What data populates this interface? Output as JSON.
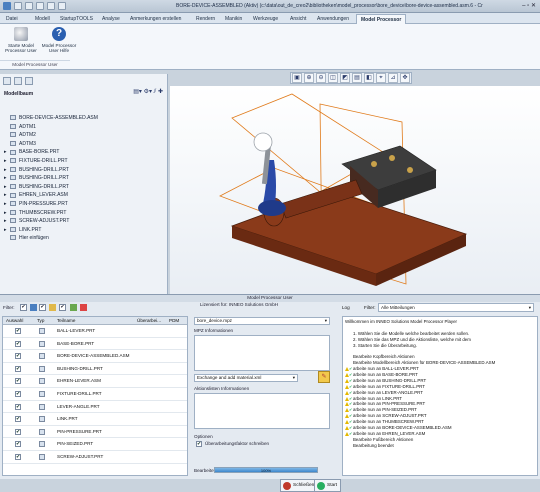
{
  "titlebar": {
    "title": "BORE-DEVICE-ASSEMBLED (Aktiv) (c:\\data\\out_de_creo2\\bibliotheken\\model_processor\\bore_device\\bore-device-assembled.asm.6 - Cr"
  },
  "ribbon": {
    "tabs": [
      "Datei",
      "Modell",
      "StartupTOOLS",
      "Analyse",
      "Anmerkungen erstellen",
      "Rendern",
      "Manikin",
      "Werkzeuge",
      "Ansicht",
      "Anwendungen",
      "Model Processor"
    ],
    "active_tab": "Model Processor",
    "buttons": [
      {
        "label": "Starte Model Processor User",
        "icon": "model-processor-icon"
      },
      {
        "label": "Model Processor User Hilfe",
        "icon": "help-icon"
      }
    ],
    "group_label": "Model Processor User"
  },
  "model_tree": {
    "header": "Modellbaum",
    "items": [
      {
        "label": "BORE-DEVICE-ASSEMBLED.ASM",
        "expand": ""
      },
      {
        "label": "ADTM1",
        "expand": ""
      },
      {
        "label": "ADTM2",
        "expand": ""
      },
      {
        "label": "ADTM3",
        "expand": ""
      },
      {
        "label": "BASE-BORE.PRT",
        "expand": "▸"
      },
      {
        "label": "FIXTURE-DRILL.PRT",
        "expand": "▸"
      },
      {
        "label": "BUSHING-DRILL.PRT",
        "expand": "▸"
      },
      {
        "label": "BUSHING-DRILL.PRT",
        "expand": "▸"
      },
      {
        "label": "BUSHING-DRILL.PRT",
        "expand": "▸"
      },
      {
        "label": "EHREN_LEVER.ASM",
        "expand": "▸"
      },
      {
        "label": "PIN-PRESSURE.PRT",
        "expand": "▸"
      },
      {
        "label": "THUMBSCREW.PRT",
        "expand": "▸"
      },
      {
        "label": "SCREW-ADJUST.PRT",
        "expand": "▸"
      },
      {
        "label": "LINK.PRT",
        "expand": "▸"
      },
      {
        "label": "Hier einfügen",
        "expand": ""
      }
    ]
  },
  "mpp": {
    "title": "Model Processor User",
    "filter_label": "Filter:",
    "license": "Lizensiert für:   INNEO Solutions GmbH",
    "log_label": "Log",
    "log_filter_label": "Filter:",
    "log_filter_value": "Alle Mitteilungen",
    "grid": {
      "headers": [
        "Auswahl",
        "Typ",
        "Teilname",
        "Überarbei...",
        "PDM"
      ],
      "rows": [
        {
          "checked": "✔",
          "name": "BALL-LEVER.PRT"
        },
        {
          "checked": "✔",
          "name": "BASE-BORE.PRT"
        },
        {
          "checked": "✔",
          "name": "BORE-DEVICE-ASSEMBLED.ASM"
        },
        {
          "checked": "✔",
          "name": "BUSHING-DRILL.PRT"
        },
        {
          "checked": "✔",
          "name": "EHREN-LEVER.ASM"
        },
        {
          "checked": "✔",
          "name": "FIXTURE-DRILL.PRT"
        },
        {
          "checked": "✔",
          "name": "LEVER-ANGLE.PRT"
        },
        {
          "checked": "✔",
          "name": "LINK.PRT"
        },
        {
          "checked": "✔",
          "name": "PIN-PRESSURE.PRT"
        },
        {
          "checked": "✔",
          "name": "PIN-SEIZED.PRT"
        },
        {
          "checked": "✔",
          "name": "SCREW-ADJUST.PRT"
        }
      ]
    },
    "mpz_file": "bore_device.mpz",
    "mpz_info_label": "MPZ Informationen",
    "action_value": "Exchange and add material.xml",
    "action_info_label": "Aktionslisten Informationen",
    "options_label": "Optionen",
    "option_checkbox": "Überarbeitungsfaktor schreiben",
    "progress_label": "Bearbeitet:",
    "progress_text": "100%",
    "progress_value": 1.0,
    "buttons": {
      "close": "Schließen",
      "start": "Start"
    },
    "log_lines": [
      {
        "text": "Willkommen im INNEO Solutions Model Processor Player",
        "icon": "",
        "indent": false
      },
      {
        "text": "",
        "icon": "",
        "indent": false
      },
      {
        "text": "1. Wählen Sie die Modelle welche bearbeitet werden sollen.",
        "icon": "",
        "indent": true
      },
      {
        "text": "2. Wählen Sie das MPZ und die Aktionsliste, welche mit dem",
        "icon": "",
        "indent": true
      },
      {
        "text": "3. Starten Sie die Überarbeitung.",
        "icon": "",
        "indent": true
      },
      {
        "text": "",
        "icon": "",
        "indent": false
      },
      {
        "text": "Bearbeite Kopfbereich Aktionen",
        "icon": "",
        "indent": true
      },
      {
        "text": "Bearbeite Modellbereich Aktionen für BORE-DEVICE-ASSEMBLED.ASM",
        "icon": "",
        "indent": true
      },
      {
        "text": "arbeite nun an BALL-LEVER.PRT",
        "icon": "warn",
        "indent": true
      },
      {
        "text": "arbeite nun an BASE-BORE.PRT",
        "icon": "warn",
        "indent": true
      },
      {
        "text": "arbeite nun an BUSHING-DRILL.PRT",
        "icon": "warn",
        "indent": true
      },
      {
        "text": "arbeite nun an FIXTURE-DRILL.PRT",
        "icon": "warn",
        "indent": true
      },
      {
        "text": "arbeite nun an LEVER-ANGLE.PRT",
        "icon": "warn",
        "indent": true
      },
      {
        "text": "arbeite nun an LINK.PRT",
        "icon": "warn",
        "indent": true
      },
      {
        "text": "arbeite nun an PIN-PRESSURE.PRT",
        "icon": "warn",
        "indent": true
      },
      {
        "text": "arbeite nun an PIN-SEIZED.PRT",
        "icon": "warn",
        "indent": true
      },
      {
        "text": "arbeite nun an SCREW-ADJUST.PRT",
        "icon": "warn",
        "indent": true
      },
      {
        "text": "arbeite nun an THUMBSCREW.PRT",
        "icon": "warn",
        "indent": true
      },
      {
        "text": "arbeite nun an BORE-DEVICE-ASSEMBLED.ASM",
        "icon": "warn",
        "indent": true
      },
      {
        "text": "arbeite nun an EHREN_LEVER.ASM",
        "icon": "warn",
        "indent": true
      },
      {
        "text": "Bearbeite Fußbereich Aktionen",
        "icon": "",
        "indent": true
      },
      {
        "text": "Bearbeitung beendet",
        "icon": "",
        "indent": true
      }
    ]
  },
  "colors": {
    "accent": "#3d87cc",
    "model_brown": "#8a3a1a",
    "model_blue": "#2a4aa8",
    "frame_orange": "#e07a1a"
  }
}
